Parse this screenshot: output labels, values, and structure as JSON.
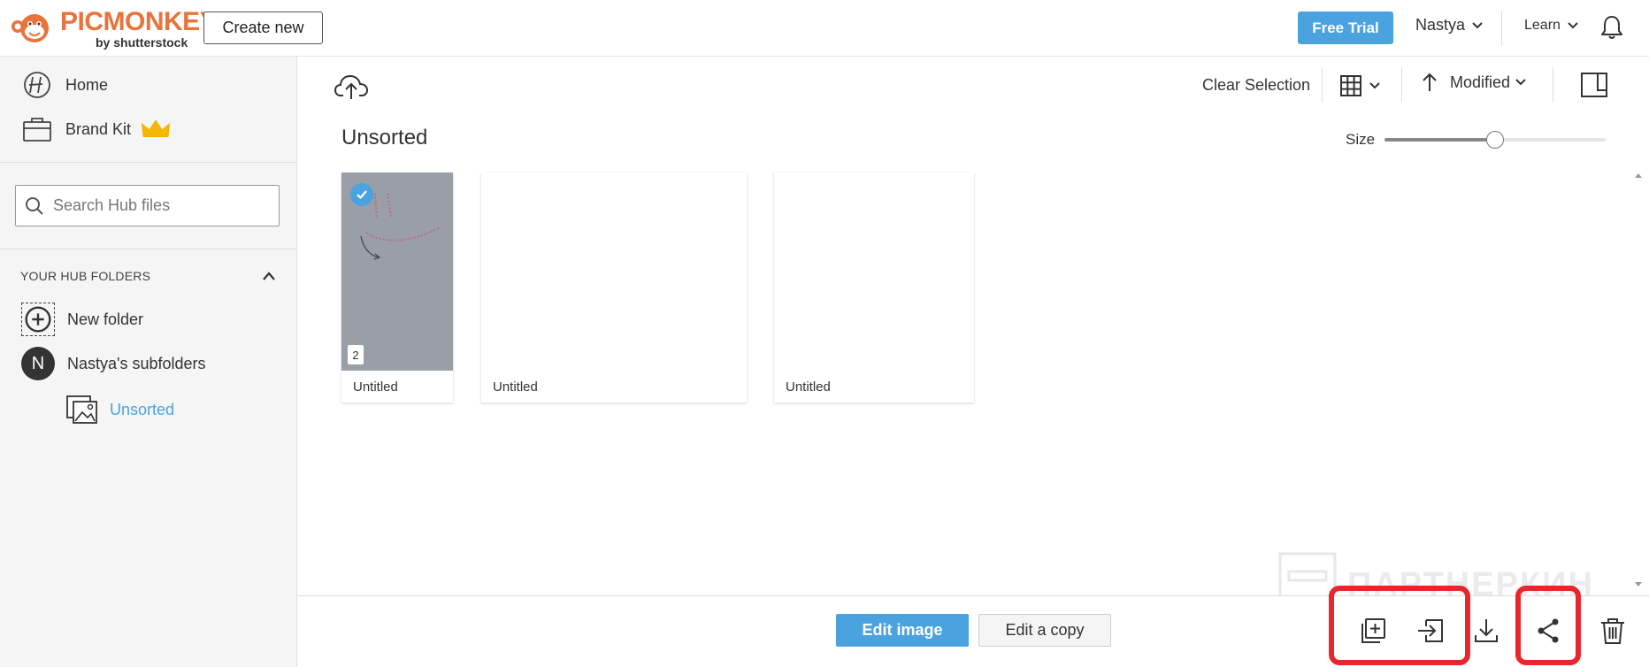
{
  "header": {
    "logo_word": "PICMONKEY",
    "logo_sub": "by shutterstock",
    "create_new_label": "Create new",
    "free_trial_label": "Free Trial",
    "user_name": "Nastya",
    "learn_label": "Learn"
  },
  "sidebar": {
    "home_label": "Home",
    "brand_kit_label": "Brand Kit",
    "search_placeholder": "Search Hub files",
    "folders_header": "YOUR HUB FOLDERS",
    "new_folder_label": "New folder",
    "avatar_initial": "N",
    "subfolders_label": "Nastya's subfolders",
    "unsorted_label": "Unsorted"
  },
  "toolbar": {
    "clear_selection_label": "Clear Selection",
    "sort_label": "Modified",
    "folder_title": "Unsorted",
    "size_label": "Size",
    "size_value_percent": 50
  },
  "files": [
    {
      "label": "Untitled",
      "selected": true,
      "page_count": "2"
    },
    {
      "label": "Untitled",
      "selected": false
    },
    {
      "label": "Untitled",
      "selected": false
    }
  ],
  "bottombar": {
    "edit_image_label": "Edit image",
    "edit_copy_label": "Edit a copy"
  },
  "watermark": {
    "text": "ПАРТНЕРКИН"
  },
  "colors": {
    "accent": "#4aa3df",
    "brand_orange": "#e8743b",
    "highlight_red": "#e8262b",
    "thumb_gray": "#9a9ea6"
  }
}
